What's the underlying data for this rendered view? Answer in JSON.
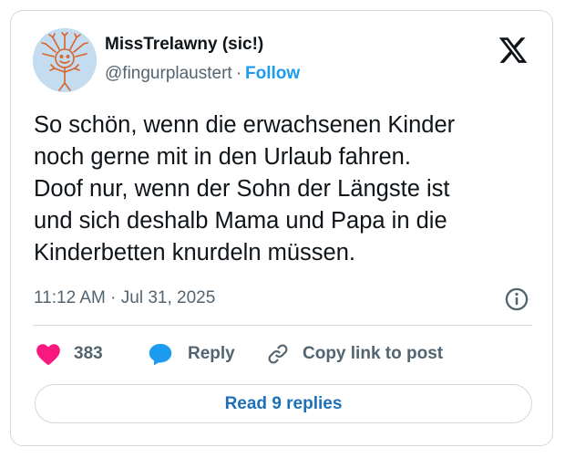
{
  "author": {
    "display_name": "MissTrelawny (sic!)",
    "handle": "@fingurplaustert",
    "separator": "·",
    "follow_label": "Follow"
  },
  "tweet": {
    "text": "So schön, wenn die erwachsenen Kinder\nnoch gerne mit in den Urlaub fahren.\nDoof nur, wenn der Sohn der Längste ist\nund sich deshalb Mama und Papa in die\nKinderbetten knurdeln müssen.",
    "timestamp": "11:12 AM · Jul 31, 2025"
  },
  "actions": {
    "like_count": "383",
    "reply_label": "Reply",
    "copy_label": "Copy link to post"
  },
  "footer": {
    "read_replies_label": "Read 9 replies"
  },
  "icons": {
    "platform": "x-logo-icon",
    "info": "info-icon",
    "like": "heart-icon",
    "reply": "speech-bubble-icon",
    "copy": "link-icon"
  },
  "colors": {
    "follow": "#1d9bf0",
    "heart": "#f91880",
    "reply_bubble": "#1d9bf0",
    "read_replies": "#1d70b8",
    "secondary_text": "#536471",
    "border": "#cfd9de"
  }
}
